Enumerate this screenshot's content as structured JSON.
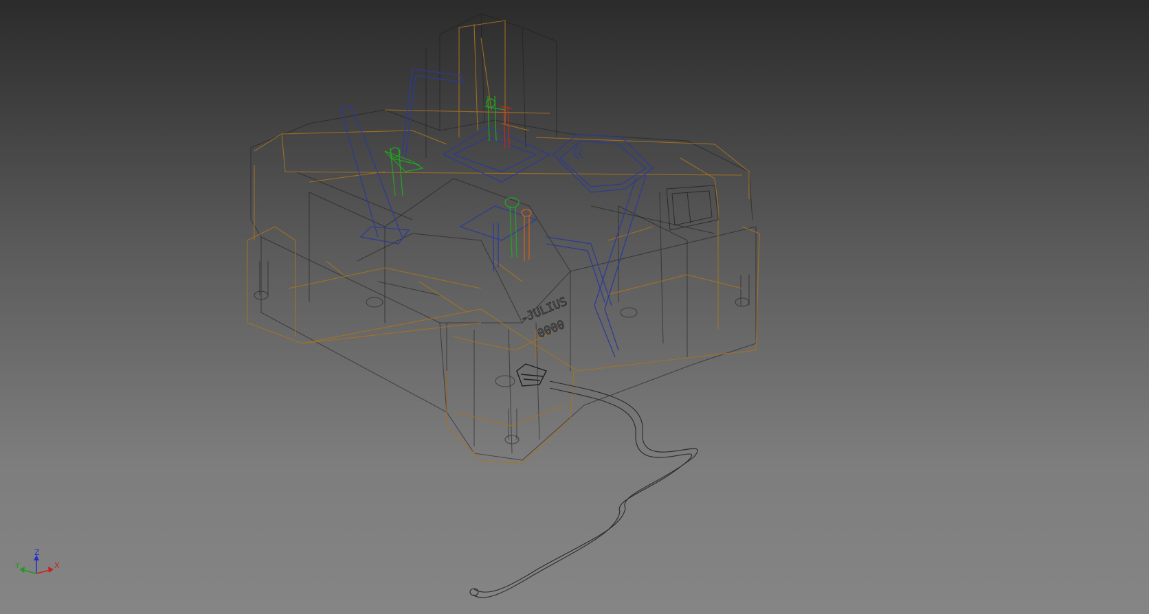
{
  "viewport": {
    "label": "3d-model-viewport",
    "model_text": {
      "line1": "-JULIUS",
      "line2": "0000"
    }
  },
  "view_triad": {
    "z_label": "Z",
    "y_label": "Y",
    "x_label": "X"
  },
  "colors": {
    "background_top": "#2b2b2b",
    "background_bottom": "#858585",
    "body_edges": "#1e1e1e",
    "shell_edges": "#a8731e",
    "frame_edges": "#2a3a9a",
    "component_green": "#1fa81f",
    "component_red": "#c0281e",
    "component_orange": "#d0601a",
    "axis_x": "#c8201e",
    "axis_y": "#1f9a1f",
    "axis_z": "#1f2fc8"
  }
}
